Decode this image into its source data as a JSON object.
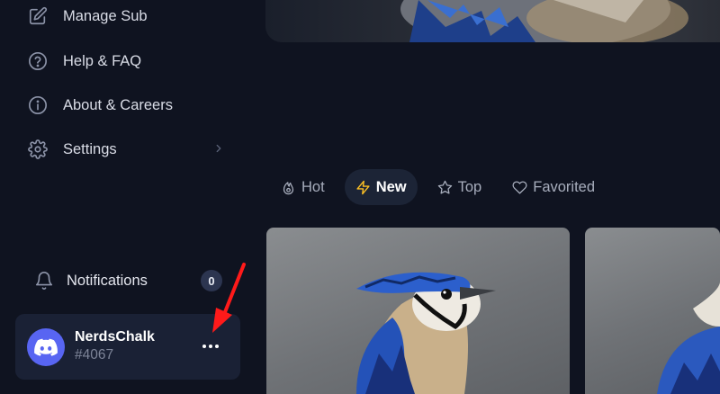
{
  "sidebar": {
    "items": [
      {
        "label": "Manage Sub",
        "icon": "edit-icon"
      },
      {
        "label": "Help & FAQ",
        "icon": "help-circle-icon"
      },
      {
        "label": "About & Careers",
        "icon": "info-circle-icon"
      },
      {
        "label": "Settings",
        "icon": "gear-icon"
      }
    ],
    "notifications": {
      "label": "Notifications",
      "count": "0"
    },
    "user": {
      "name": "NerdsChalk",
      "tag": "#4067",
      "more_label": "..."
    }
  },
  "tabs": [
    {
      "label": "Hot",
      "icon": "flame-icon",
      "active": false
    },
    {
      "label": "New",
      "icon": "lightning-icon",
      "active": true
    },
    {
      "label": "Top",
      "icon": "star-icon",
      "active": false
    },
    {
      "label": "Favorited",
      "icon": "heart-icon",
      "active": false
    }
  ],
  "colors": {
    "background": "#0f1320",
    "card": "#1a2135",
    "accent": "#fbbf24",
    "discord": "#5865f2",
    "annotation": "#ff1a1a"
  }
}
